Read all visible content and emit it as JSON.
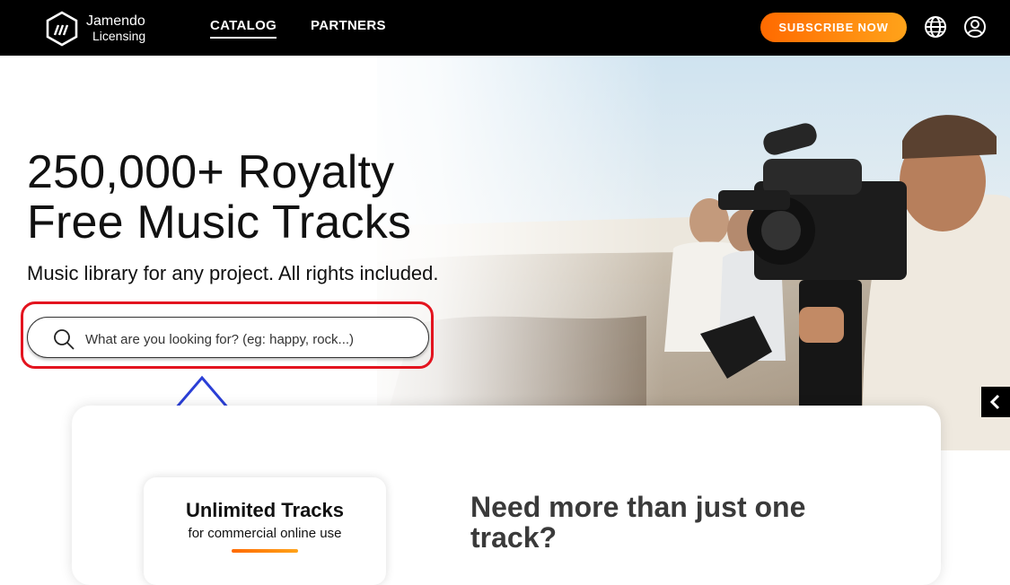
{
  "header": {
    "brand_line1": "Jamendo",
    "brand_line2": "Licensing",
    "nav": [
      {
        "label": "CATALOG",
        "active": true
      },
      {
        "label": "PARTNERS",
        "active": false
      }
    ],
    "subscribe_label": "SUBSCRIBE NOW",
    "icons": [
      "globe-icon",
      "user-account-icon"
    ]
  },
  "hero": {
    "headline": "250,000+ Royalty Free Music Tracks",
    "subheadline": "Music library for any project. All rights included.",
    "search": {
      "value": "",
      "placeholder": "What are you looking for? (eg: happy, rock...)"
    },
    "slider_prev_icon": "chevron-left-icon"
  },
  "pricing": {
    "plan_title": "Unlimited Tracks",
    "plan_subtitle": "for commercial online use",
    "cta_heading": "Need more than just one track?"
  },
  "colors": {
    "accent_start": "#ff6a00",
    "accent_end": "#ffa31a",
    "annotation_box": "#e3141f",
    "annotation_arrow": "#2b3fd6"
  }
}
